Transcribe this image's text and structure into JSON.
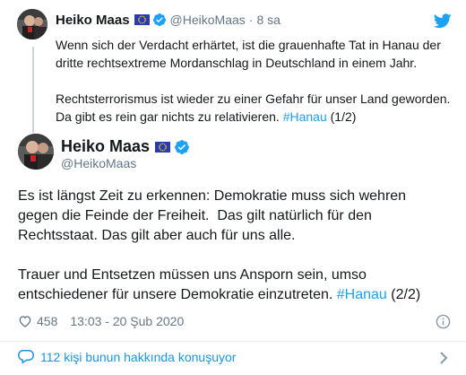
{
  "previous_tweet": {
    "author_name": "Heiko Maas",
    "handle": "@HeikoMaas",
    "separator": "·",
    "time": "8 sa",
    "paragraph1": "Wenn sich der Verdacht erhärtet, ist die grauenhafte Tat in Hanau der dritte rechtsextreme Mordanschlag in Deutschland in einem Jahr.",
    "paragraph2_text": "Rechtsterrorismus ist wieder zu einer Gefahr für unser Land geworden. Da gibt es rein gar nichts zu relativieren.",
    "paragraph2_hashtag": "#Hanau",
    "paragraph2_suffix": "(1/2)"
  },
  "main_tweet": {
    "author_name": "Heiko Maas",
    "handle": "@HeikoMaas",
    "paragraph1": "Es ist längst Zeit zu erkennen: Demokratie muss sich wehren gegen die Feinde der Freiheit.  Das gilt natürlich für den Rechtsstaat. Das gilt aber auch für uns alle.",
    "paragraph2_text": "Trauer und Entsetzen müssen uns Ansporn sein, umso entschiedener für unsere Demokratie einzutreten.",
    "paragraph2_hashtag": "#Hanau",
    "paragraph2_suffix": "(2/2)",
    "like_count": "458",
    "timestamp": "13:03 - 20 Şub 2020"
  },
  "conversation": {
    "label": "112 kişi bunun hakkında konuşuyor"
  },
  "icons": {
    "flag": "eu-flag-icon",
    "verified": "verified-badge-icon",
    "brand": "twitter-bird-icon",
    "like": "heart-icon",
    "info": "info-icon",
    "reply": "speech-bubble-icon",
    "more": "chevron-right-icon"
  },
  "colors": {
    "link": "#1da1f2",
    "conversation_link": "#1b95e0",
    "secondary_text": "#657786",
    "primary_text": "#14171a",
    "verified_badge": "#1da1f2",
    "flag_blue": "#2a3bb0"
  }
}
